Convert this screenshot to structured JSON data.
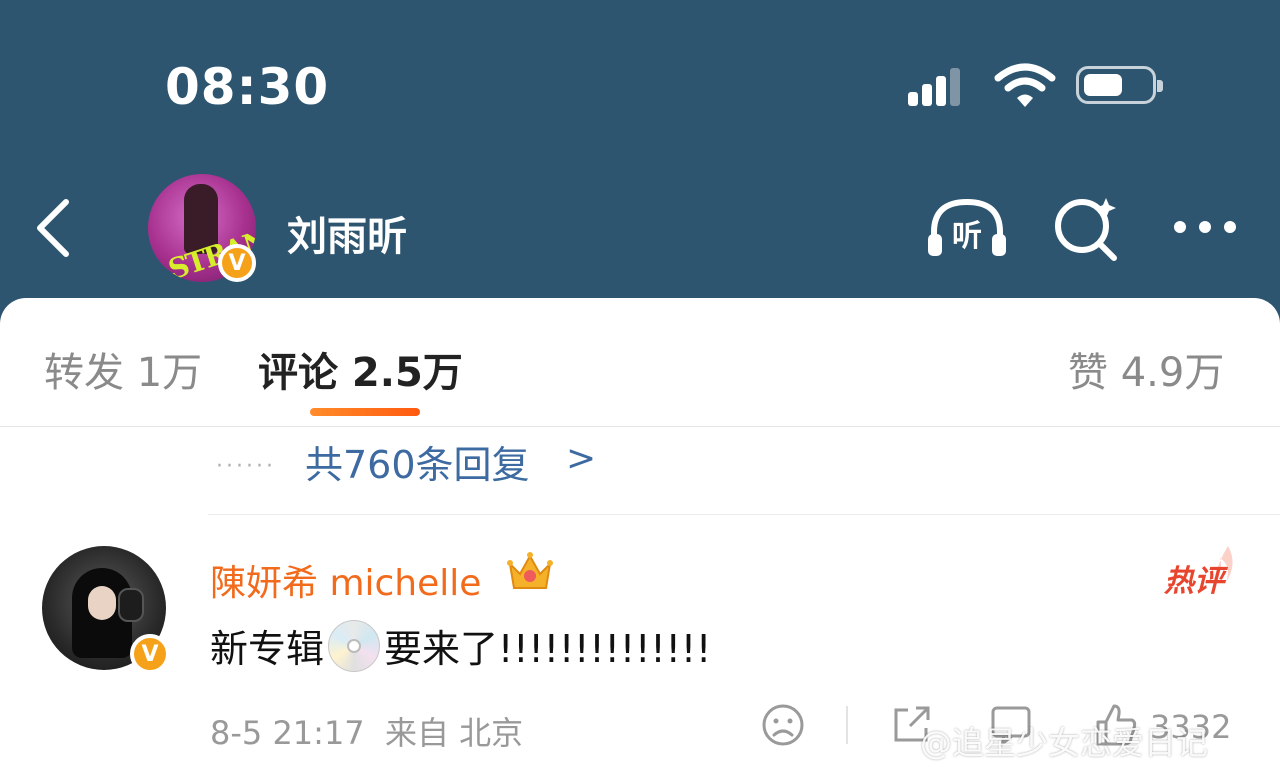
{
  "status_bar": {
    "time": "08:30"
  },
  "header": {
    "name": "刘雨昕",
    "avatar_logo": "STRANGE"
  },
  "tabs": [
    {
      "label": "转发 1万"
    },
    {
      "label": "评论 2.5万",
      "active": true
    },
    {
      "label": "赞 4.9万"
    }
  ],
  "replies": {
    "dots": "······",
    "count_text": "共760条回复",
    "chevron": ">"
  },
  "comment": {
    "author": "陳妍希 michelle",
    "hot_label": "热评",
    "text_before": "新专辑",
    "text_after": "要来了!!!!!!!!!!!!!!",
    "time": "8-5 21:17",
    "source": "来自 北京",
    "likes": "3332"
  },
  "badge_letter": "V",
  "watermark": "@追星少女恋爱日记",
  "colors": {
    "header_bg": "#2d5570",
    "accent": "#f26b1d",
    "link": "#3d6aa0",
    "verified": "#f6a11a"
  },
  "icons": [
    "back-arrow-icon",
    "listen-icon",
    "search-sparkle-icon",
    "more-dots-icon",
    "crown-icon",
    "cd-disc-icon",
    "dislike-face-icon",
    "share-icon",
    "comment-icon",
    "like-thumb-icon"
  ]
}
